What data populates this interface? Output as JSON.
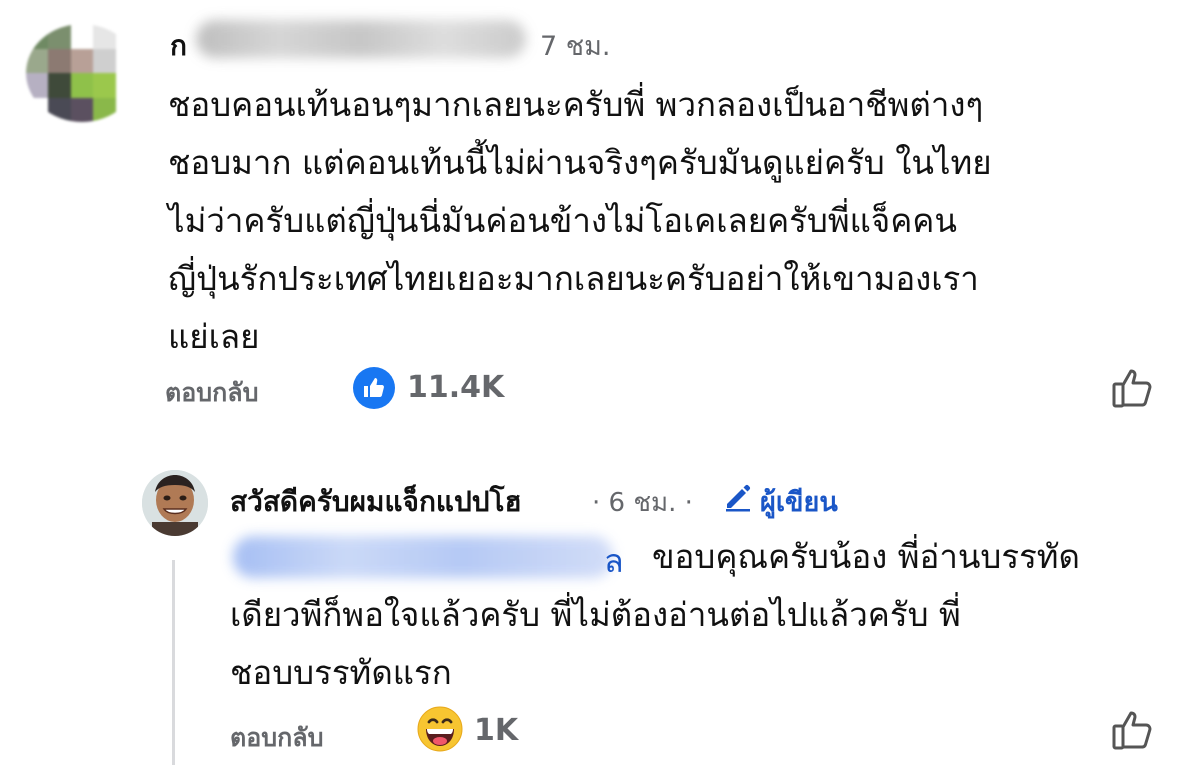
{
  "comment": {
    "author_visible_prefix": "ก",
    "time": "7 ชม.",
    "lines": [
      "ชอบคอนเท้นอนๆมากเลยนะครับพี่ พวกลองเป็นอาชีพต่างๆ",
      "ชอบมาก แต่คอนเท้นนี้ไม่ผ่านจริงๆครับมันดูแย่ครับ ในไทย",
      "ไม่ว่าครับแต่ญี่ปุ่นนี่มันค่อนข้างไม่โอเคเลยครับพี่แจ็คคน",
      "ญี่ปุ่นรักประเทศไทยเยอะมากเลยนะครับอย่าให้เขามองเรา",
      "แย่เลย"
    ],
    "reply_label": "ตอบกลับ",
    "reaction_icon": "thumbs-up-badge",
    "reaction_count": "11.4K"
  },
  "reply": {
    "author": "สวัสดีครับผมแจ็กแปปโฮ",
    "meta": "· 6 ชม. ·",
    "author_badge": "ผู้เขียน",
    "mention_visible_tail": "ล",
    "lines": [
      "ขอบคุณครับน้อง พี่อ่านบรรทัด",
      "เดียวพีก็พอใจแล้วครับ พี่ไม่ต้องอ่านต่อไปแล้วครับ พี่",
      "ชอบบรรทัดแรก"
    ],
    "reply_label": "ตอบกลับ",
    "reaction_icon": "grinning-emoji",
    "reaction_count": "1K"
  },
  "colors": {
    "secondary_text": "#65676b",
    "link_blue": "#1a56c7",
    "like_blue": "#1877f2"
  }
}
